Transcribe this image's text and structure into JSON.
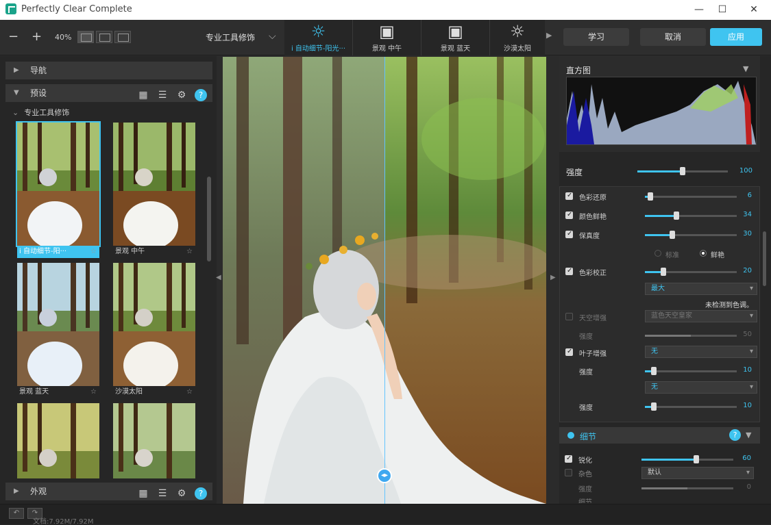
{
  "window": {
    "title": "Perfectly Clear Complete",
    "minimize": "—",
    "maximize": "☐",
    "close": "✕"
  },
  "toolbar": {
    "zoom_out": "−",
    "zoom_in": "+",
    "zoom_level": "40%",
    "preset_group": "专业工具修饰",
    "presets": [
      {
        "label": "i 自动细节-阳光···",
        "icon": "sun-icon",
        "glyph": "☼"
      },
      {
        "label": "景观  中午",
        "icon": "landscape-icon",
        "glyph": "▣"
      },
      {
        "label": "景观  蓝天",
        "icon": "landscape-icon",
        "glyph": "▣"
      },
      {
        "label": "沙漠太阳",
        "icon": "sun-icon",
        "glyph": "☼"
      }
    ],
    "learn": "学习",
    "cancel": "取消",
    "apply": "应用"
  },
  "left": {
    "nav_title": "导航",
    "presets_title": "预设",
    "group_title": "专业工具修饰",
    "thumbs": [
      {
        "label": "i 自动细节-阳···",
        "star": "☆"
      },
      {
        "label": "景观  中午",
        "star": "☆"
      },
      {
        "label": "景观  蓝天",
        "star": "☆"
      },
      {
        "label": "沙漠太阳",
        "star": "☆"
      },
      {
        "label": "",
        "star": ""
      },
      {
        "label": "",
        "star": ""
      }
    ],
    "appearance_title": "外观",
    "help": "?"
  },
  "right": {
    "histogram_title": "直方图",
    "strength_label": "强度",
    "strength_value": "100",
    "strength_level": 0.5,
    "rows": [
      {
        "label": "色彩还原",
        "value": "6",
        "checked": true,
        "level": 0.06
      },
      {
        "label": "颜色鲜艳",
        "value": "34",
        "checked": true,
        "level": 0.34
      },
      {
        "label": "保真度",
        "value": "30",
        "checked": true,
        "level": 0.3
      }
    ],
    "mode_standard": "标准",
    "mode_vivid": "鲜艳",
    "color_correction": {
      "label": "色彩校正",
      "value": "20",
      "level": 0.2,
      "dropdown": "最大",
      "note": "未检测到色调。"
    },
    "sky": {
      "label": "天空增强",
      "dropdown": "蓝色天空皇家",
      "sub": "强度",
      "value": "50",
      "level": 0.5
    },
    "foliage": {
      "label": "叶子增强",
      "dropdown": "无",
      "sub": "强度",
      "value": "10",
      "level": 0.1,
      "dropdown2": "无",
      "sub2": "强度",
      "value2": "10",
      "level2": 0.1
    },
    "detail_title": "细节",
    "sharpen": {
      "label": "锐化",
      "value": "60",
      "level": 0.6
    },
    "noise": {
      "label": "杂色",
      "dropdown": "默认"
    },
    "noise_strength": {
      "label": "强度",
      "value": "0",
      "level": 0.5
    },
    "last_row_label": "细节"
  },
  "status": {
    "file_info": "文档:7.92M/7.92M"
  },
  "colors": {
    "accent": "#3fc4f0",
    "panel": "#262626",
    "header": "#383838"
  }
}
